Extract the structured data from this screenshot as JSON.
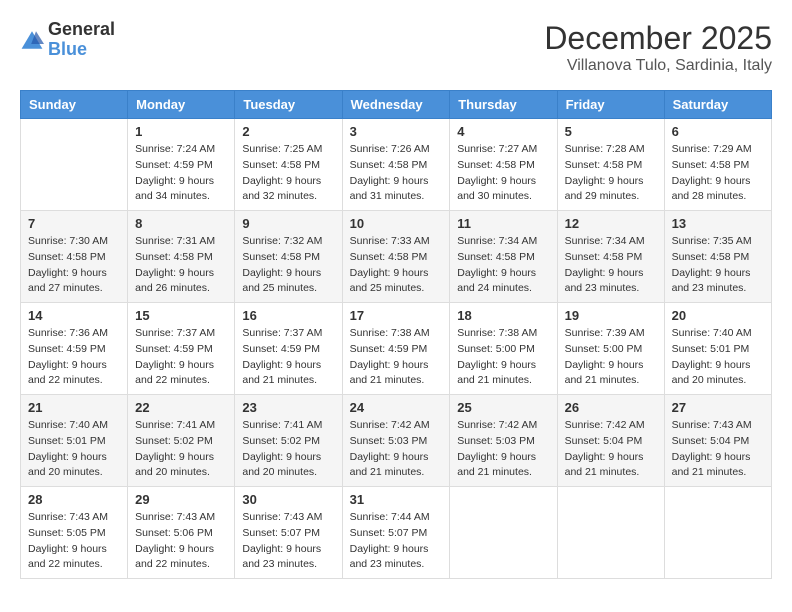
{
  "logo": {
    "general": "General",
    "blue": "Blue"
  },
  "title": {
    "month": "December 2025",
    "location": "Villanova Tulo, Sardinia, Italy"
  },
  "headers": [
    "Sunday",
    "Monday",
    "Tuesday",
    "Wednesday",
    "Thursday",
    "Friday",
    "Saturday"
  ],
  "weeks": [
    [
      {
        "day": "",
        "sunrise": "",
        "sunset": "",
        "daylight": ""
      },
      {
        "day": "1",
        "sunrise": "Sunrise: 7:24 AM",
        "sunset": "Sunset: 4:59 PM",
        "daylight": "Daylight: 9 hours and 34 minutes."
      },
      {
        "day": "2",
        "sunrise": "Sunrise: 7:25 AM",
        "sunset": "Sunset: 4:58 PM",
        "daylight": "Daylight: 9 hours and 32 minutes."
      },
      {
        "day": "3",
        "sunrise": "Sunrise: 7:26 AM",
        "sunset": "Sunset: 4:58 PM",
        "daylight": "Daylight: 9 hours and 31 minutes."
      },
      {
        "day": "4",
        "sunrise": "Sunrise: 7:27 AM",
        "sunset": "Sunset: 4:58 PM",
        "daylight": "Daylight: 9 hours and 30 minutes."
      },
      {
        "day": "5",
        "sunrise": "Sunrise: 7:28 AM",
        "sunset": "Sunset: 4:58 PM",
        "daylight": "Daylight: 9 hours and 29 minutes."
      },
      {
        "day": "6",
        "sunrise": "Sunrise: 7:29 AM",
        "sunset": "Sunset: 4:58 PM",
        "daylight": "Daylight: 9 hours and 28 minutes."
      }
    ],
    [
      {
        "day": "7",
        "sunrise": "Sunrise: 7:30 AM",
        "sunset": "Sunset: 4:58 PM",
        "daylight": "Daylight: 9 hours and 27 minutes."
      },
      {
        "day": "8",
        "sunrise": "Sunrise: 7:31 AM",
        "sunset": "Sunset: 4:58 PM",
        "daylight": "Daylight: 9 hours and 26 minutes."
      },
      {
        "day": "9",
        "sunrise": "Sunrise: 7:32 AM",
        "sunset": "Sunset: 4:58 PM",
        "daylight": "Daylight: 9 hours and 25 minutes."
      },
      {
        "day": "10",
        "sunrise": "Sunrise: 7:33 AM",
        "sunset": "Sunset: 4:58 PM",
        "daylight": "Daylight: 9 hours and 25 minutes."
      },
      {
        "day": "11",
        "sunrise": "Sunrise: 7:34 AM",
        "sunset": "Sunset: 4:58 PM",
        "daylight": "Daylight: 9 hours and 24 minutes."
      },
      {
        "day": "12",
        "sunrise": "Sunrise: 7:34 AM",
        "sunset": "Sunset: 4:58 PM",
        "daylight": "Daylight: 9 hours and 23 minutes."
      },
      {
        "day": "13",
        "sunrise": "Sunrise: 7:35 AM",
        "sunset": "Sunset: 4:58 PM",
        "daylight": "Daylight: 9 hours and 23 minutes."
      }
    ],
    [
      {
        "day": "14",
        "sunrise": "Sunrise: 7:36 AM",
        "sunset": "Sunset: 4:59 PM",
        "daylight": "Daylight: 9 hours and 22 minutes."
      },
      {
        "day": "15",
        "sunrise": "Sunrise: 7:37 AM",
        "sunset": "Sunset: 4:59 PM",
        "daylight": "Daylight: 9 hours and 22 minutes."
      },
      {
        "day": "16",
        "sunrise": "Sunrise: 7:37 AM",
        "sunset": "Sunset: 4:59 PM",
        "daylight": "Daylight: 9 hours and 21 minutes."
      },
      {
        "day": "17",
        "sunrise": "Sunrise: 7:38 AM",
        "sunset": "Sunset: 4:59 PM",
        "daylight": "Daylight: 9 hours and 21 minutes."
      },
      {
        "day": "18",
        "sunrise": "Sunrise: 7:38 AM",
        "sunset": "Sunset: 5:00 PM",
        "daylight": "Daylight: 9 hours and 21 minutes."
      },
      {
        "day": "19",
        "sunrise": "Sunrise: 7:39 AM",
        "sunset": "Sunset: 5:00 PM",
        "daylight": "Daylight: 9 hours and 21 minutes."
      },
      {
        "day": "20",
        "sunrise": "Sunrise: 7:40 AM",
        "sunset": "Sunset: 5:01 PM",
        "daylight": "Daylight: 9 hours and 20 minutes."
      }
    ],
    [
      {
        "day": "21",
        "sunrise": "Sunrise: 7:40 AM",
        "sunset": "Sunset: 5:01 PM",
        "daylight": "Daylight: 9 hours and 20 minutes."
      },
      {
        "day": "22",
        "sunrise": "Sunrise: 7:41 AM",
        "sunset": "Sunset: 5:02 PM",
        "daylight": "Daylight: 9 hours and 20 minutes."
      },
      {
        "day": "23",
        "sunrise": "Sunrise: 7:41 AM",
        "sunset": "Sunset: 5:02 PM",
        "daylight": "Daylight: 9 hours and 20 minutes."
      },
      {
        "day": "24",
        "sunrise": "Sunrise: 7:42 AM",
        "sunset": "Sunset: 5:03 PM",
        "daylight": "Daylight: 9 hours and 21 minutes."
      },
      {
        "day": "25",
        "sunrise": "Sunrise: 7:42 AM",
        "sunset": "Sunset: 5:03 PM",
        "daylight": "Daylight: 9 hours and 21 minutes."
      },
      {
        "day": "26",
        "sunrise": "Sunrise: 7:42 AM",
        "sunset": "Sunset: 5:04 PM",
        "daylight": "Daylight: 9 hours and 21 minutes."
      },
      {
        "day": "27",
        "sunrise": "Sunrise: 7:43 AM",
        "sunset": "Sunset: 5:04 PM",
        "daylight": "Daylight: 9 hours and 21 minutes."
      }
    ],
    [
      {
        "day": "28",
        "sunrise": "Sunrise: 7:43 AM",
        "sunset": "Sunset: 5:05 PM",
        "daylight": "Daylight: 9 hours and 22 minutes."
      },
      {
        "day": "29",
        "sunrise": "Sunrise: 7:43 AM",
        "sunset": "Sunset: 5:06 PM",
        "daylight": "Daylight: 9 hours and 22 minutes."
      },
      {
        "day": "30",
        "sunrise": "Sunrise: 7:43 AM",
        "sunset": "Sunset: 5:07 PM",
        "daylight": "Daylight: 9 hours and 23 minutes."
      },
      {
        "day": "31",
        "sunrise": "Sunrise: 7:44 AM",
        "sunset": "Sunset: 5:07 PM",
        "daylight": "Daylight: 9 hours and 23 minutes."
      },
      {
        "day": "",
        "sunrise": "",
        "sunset": "",
        "daylight": ""
      },
      {
        "day": "",
        "sunrise": "",
        "sunset": "",
        "daylight": ""
      },
      {
        "day": "",
        "sunrise": "",
        "sunset": "",
        "daylight": ""
      }
    ]
  ]
}
